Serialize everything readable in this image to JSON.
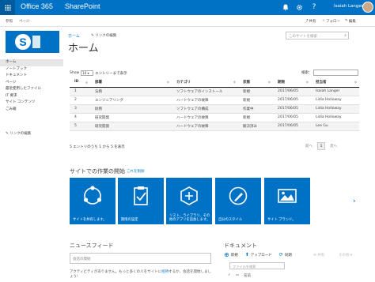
{
  "suite_bar": {
    "brand": "Office 365",
    "app": "SharePoint",
    "user": "Isaiah Langer",
    "icons": [
      "bell-icon",
      "gear-icon",
      "help-icon"
    ],
    "color": "#0072c6"
  },
  "ribbon": {
    "tabs": [
      "参照",
      "ページ"
    ],
    "actions": [
      "共有",
      "フォロー",
      "編集"
    ]
  },
  "header": {
    "breadcrumb_home": "ホーム",
    "edit_links": "リンクの編集",
    "title": "ホーム",
    "search_placeholder": "このサイトを検索"
  },
  "leftnav": {
    "items": [
      "ホーム",
      "ノートブック",
      "ドキュメント",
      "ページ",
      "最近使用したファイル",
      "IT 要求",
      "サイト コンテンツ",
      "ごみ箱"
    ],
    "edit_links": "リンクの編集"
  },
  "table": {
    "show_prefix": "Show",
    "page_size": "10",
    "show_suffix": "エントリーまで表示",
    "search_label": "検索:",
    "columns": [
      "ID",
      "部署",
      "カテゴリ",
      "状態",
      "期限",
      "担当者"
    ],
    "rows": [
      [
        "1",
        "法務",
        "ソフトウェアのインストール",
        "新規",
        "2017/06/05",
        "Isaiah Langer"
      ],
      [
        "2",
        "エンジニアリング",
        "ハードウェアの故障",
        "新規",
        "2017/06/05",
        "Lidia Holloway"
      ],
      [
        "3",
        "財務",
        "ソフトウェアの構成",
        "作業中",
        "2017/06/05",
        "Lidia Holloway"
      ],
      [
        "4",
        "研究開発",
        "ハードウェアの故障",
        "新規",
        "2017/06/05",
        "Lidia Holloway"
      ],
      [
        "5",
        "研究開発",
        "ハードウェアの故障",
        "解決済み",
        "2017/06/05",
        "Lee Gu"
      ]
    ],
    "entries_info": "5 エントリのうち 1 から 5 を表示",
    "pager": {
      "prev": "前へ",
      "current": "1",
      "next": "次へ"
    }
  },
  "get_started": {
    "title": "サイトでの作業の開始",
    "remove": "これを削除",
    "tiles": [
      {
        "icon": "share-icon",
        "label": "サイトを共有します。"
      },
      {
        "icon": "clipboard-check-icon",
        "label": "期限の設定"
      },
      {
        "icon": "apps-hexagon-icon",
        "label": "リスト、ライブラリ、その他のアプリを追加します。"
      },
      {
        "icon": "paint-brush-icon",
        "label": "自分のスタイル"
      },
      {
        "icon": "picture-icon",
        "label": "サイト ブランド。"
      }
    ]
  },
  "newsfeed": {
    "title": "ニュースフィード",
    "placeholder": "会話の開始",
    "msg_prefix": "アクティビティがありません。もっと多くの人をサイトに",
    "msg_link": "招待",
    "msg_suffix": "するか、会話を開始しましょう!"
  },
  "documents": {
    "title": "ドキュメント",
    "commands": [
      "新規",
      "アップロード",
      "同期"
    ],
    "extra": [
      "共有",
      "その他"
    ],
    "search_placeholder": "ファイルを検索",
    "col_name": "名前"
  }
}
